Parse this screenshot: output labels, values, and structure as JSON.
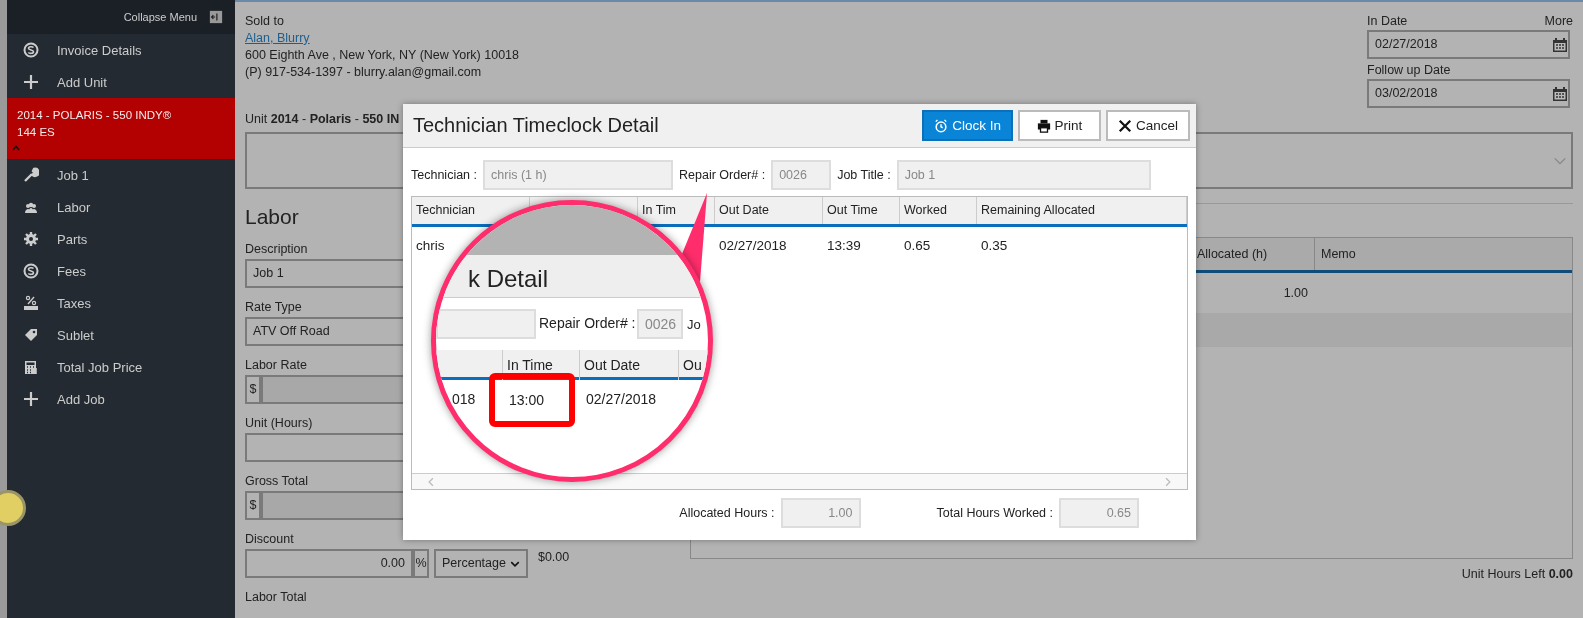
{
  "sidebar": {
    "collapse_label": "Collapse Menu",
    "items": [
      {
        "label": "Invoice Details"
      },
      {
        "label": "Add Unit"
      }
    ],
    "unit": {
      "label": "2014 - POLARIS - 550 INDY® 144 ES",
      "expanded": true
    },
    "unit_items": [
      {
        "label": "Job 1"
      },
      {
        "label": "Labor"
      },
      {
        "label": "Parts"
      },
      {
        "label": "Fees"
      },
      {
        "label": "Taxes"
      },
      {
        "label": "Sublet"
      },
      {
        "label": "Total Job Price"
      },
      {
        "label": "Add Job"
      }
    ]
  },
  "customer": {
    "heading": "Sold to",
    "name": "Alan, Blurry",
    "address": "600 Eighth Ave , New York, NY (New York) 10018",
    "contact": "(P) 917-534-1397 - blurry.alan@gmail.com"
  },
  "dates": {
    "more_label": "More",
    "fields": [
      {
        "label": "In Date",
        "value": "02/27/2018"
      },
      {
        "label": "Follow up Date",
        "value": "03/02/2018"
      }
    ]
  },
  "unit_line": "Unit **2014** - **Polaris** - **550 IN**",
  "labor": {
    "title": "Labor",
    "fields": [
      {
        "label": "Description",
        "kind": "text",
        "value": "Job 1"
      },
      {
        "label": "Rate Type",
        "kind": "text",
        "value": "ATV Off Road"
      },
      {
        "label": "Labor Rate",
        "kind": "currency",
        "prefix": "$"
      },
      {
        "label": "Unit (Hours)",
        "kind": "text"
      },
      {
        "label": "Gross Total",
        "kind": "currency",
        "prefix": "$"
      },
      {
        "label": "Discount",
        "kind": "discount",
        "value": "0.00",
        "suffix": "%",
        "mode": "Percentage",
        "amount": "$0.00"
      },
      {
        "label": "Labor Total",
        "kind": "label"
      }
    ]
  },
  "allocation_table": {
    "columns": [
      "Allocated (h)",
      "Memo"
    ],
    "rows": [
      {
        "allocated": "1.00"
      }
    ]
  },
  "unit_hours_left": {
    "label": "Unit Hours Left",
    "value": "0.00"
  },
  "modal": {
    "title": "Technician Timeclock Detail",
    "buttons": [
      {
        "label": "Clock In",
        "kind": "primary"
      },
      {
        "label": "Print",
        "kind": "default"
      },
      {
        "label": "Cancel",
        "kind": "default"
      }
    ],
    "fields": [
      {
        "label": "Technician :",
        "value": "chris (1 h)"
      },
      {
        "label": "Repair Order# :",
        "value": "0026"
      },
      {
        "label": "Job Title :",
        "value": "Job 1"
      }
    ],
    "table": {
      "columns": [
        {
          "kind": "text",
          "label": "Technician"
        },
        {
          "kind": "blank"
        },
        {
          "kind": "text",
          "label": "In Tim"
        },
        {
          "kind": "text",
          "label": "Out Date"
        },
        {
          "kind": "text",
          "label": "Out Time"
        },
        {
          "kind": "text",
          "label": "Worked"
        },
        {
          "kind": "text",
          "label": "Remaining Allocated"
        }
      ],
      "rows": [
        {
          "cells": [
            "chris",
            null,
            null,
            "02/27/2018",
            "13:39",
            "0.65",
            "0.35"
          ]
        }
      ]
    },
    "totals": [
      {
        "label": "Allocated Hours :",
        "value": "1.00"
      },
      {
        "label": "Total Hours Worked :",
        "value": "0.65"
      }
    ]
  },
  "magnifier": {
    "title": "k Detail",
    "field_label": "Repair Order# :",
    "field_value": "0026",
    "fragment": "Jo",
    "columns": [
      "In Time",
      "Out Date",
      "Ou"
    ],
    "cells": [
      {
        "text": "018",
        "highlighted": false
      },
      {
        "text": "13:00",
        "highlighted": true
      },
      {
        "text": "02/27/2018",
        "highlighted": false
      }
    ]
  }
}
